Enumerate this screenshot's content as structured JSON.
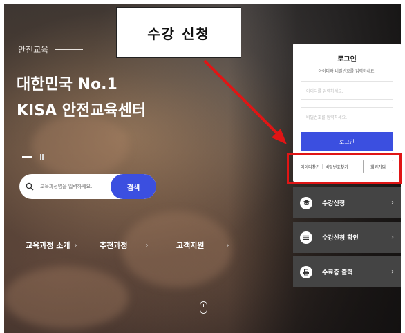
{
  "hero": {
    "kicker": "안전교육",
    "headline_line1": "대한민국 No.1",
    "headline_line2": "KISA 안전교육센터"
  },
  "search": {
    "placeholder": "교육과정명을 입력하세요.",
    "button_label": "검색",
    "icon": "search-icon"
  },
  "nav_links": [
    {
      "label": "교육과정 소개"
    },
    {
      "label": "추천과정"
    },
    {
      "label": "고객지원"
    }
  ],
  "login": {
    "title": "로그인",
    "subtitle": "아이디와 비밀번호를 입력하세요.",
    "id_placeholder": "아이디를 입력하세요.",
    "pw_placeholder": "비밀번호를 입력하세요.",
    "login_button": "로그인",
    "find_id": "아이디찾기",
    "separator": "|",
    "find_pw": "비밀번호찾기",
    "signup_button": "회원가입"
  },
  "quick_menu": [
    {
      "label": "수강신청",
      "icon": "graduation-cap-icon"
    },
    {
      "label": "수강신청 확인",
      "icon": "list-icon"
    },
    {
      "label": "수료증 출력",
      "icon": "printer-icon"
    }
  ],
  "annotation": {
    "callout_text": "수강 신청",
    "accent_color": "#e01515"
  },
  "colors": {
    "primary": "#3b4fe0",
    "quick_menu_bg": "#444444"
  }
}
